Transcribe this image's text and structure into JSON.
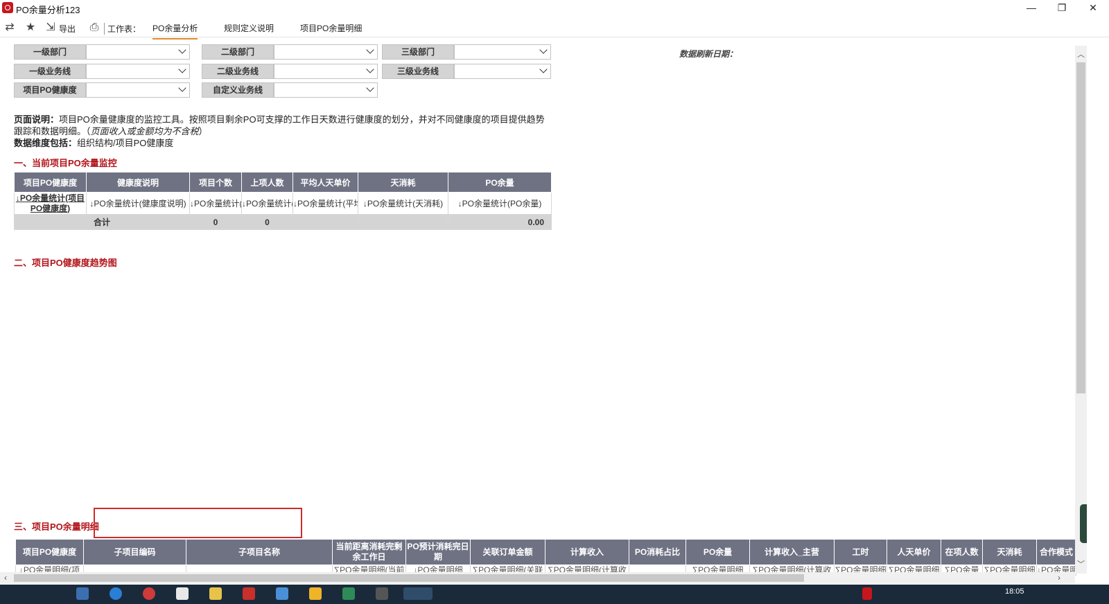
{
  "window": {
    "title": "PO余量分析123",
    "min": "—",
    "max": "❐",
    "close": "✕"
  },
  "toolbar": {
    "export_label": "导出",
    "worksheet_label": "工作表：",
    "tabs": [
      "PO余量分析",
      "规则定义说明",
      "项目PO余量明细"
    ]
  },
  "filters": {
    "row1": [
      "一级部门",
      "二级部门",
      "三级部门"
    ],
    "row2": [
      "一级业务线",
      "二级业务线",
      "三级业务线"
    ],
    "row3": [
      "项目PO健康度",
      "自定义业务线"
    ]
  },
  "refresh_date_label": "数据刷新日期：",
  "description": {
    "label1": "页面说明：",
    "text1": "项目PO余量健康度的监控工具。按照项目剩余PO可支撑的工作日天数进行健康度的划分，并对不同健康度的项目提供趋势",
    "text2": "跟踪和数据明细。（",
    "note": "页面收入或金额均为不含税",
    "text2_end": "）",
    "label2": "数据维度包括：",
    "text3": "组织结构/项目PO健康度"
  },
  "sections": {
    "s1": "一、当前项目PO余量监控",
    "s2": "二、项目PO健康度趋势图",
    "s3": "三、项目PO余量明细"
  },
  "summary_table": {
    "headers": [
      "项目PO健康度",
      "健康度说明",
      "项目个数",
      "上项人数",
      "平均人天单价",
      "天消耗",
      "PO余量"
    ],
    "row": [
      "↓PO余量统计(项目PO健康度)",
      "↓PO余量统计(健康度说明)",
      "↓PO余量统计(项目个数)",
      "↓PO余量统计(上项人数)",
      "↓PO余量统计(平均人天单价)",
      "↓PO余量统计(天消耗)",
      "↓PO余量统计(PO余量)"
    ],
    "total": [
      "合计",
      "",
      "0",
      "0",
      "",
      "",
      "0.00"
    ]
  },
  "detail_table": {
    "headers": [
      "项目PO健康度",
      "子项目编码",
      "子项目名称",
      "当前距离消耗完剩余工作日",
      "PO预计消耗完日期",
      "关联订单金额",
      "计算收入",
      "PO消耗占比",
      "PO余量",
      "计算收入_主营",
      "工时",
      "人天单价",
      "在项人数",
      "天消耗",
      "合作模式"
    ],
    "row": [
      "↓PO余量明细(项",
      "",
      "",
      "∑PO余量明细(当前",
      "↓PO余量明细",
      "∑PO余量明细(关联",
      "∑PO余量明细(计算收",
      "",
      "∑PO余量明细",
      "∑PO余量明细(计算收",
      "∑PO余量明细",
      "∑PO余量明细",
      "∑PO余量",
      "∑PO余量明细",
      "↓PO余量明"
    ]
  },
  "taskbar": {
    "time": "18:05"
  }
}
